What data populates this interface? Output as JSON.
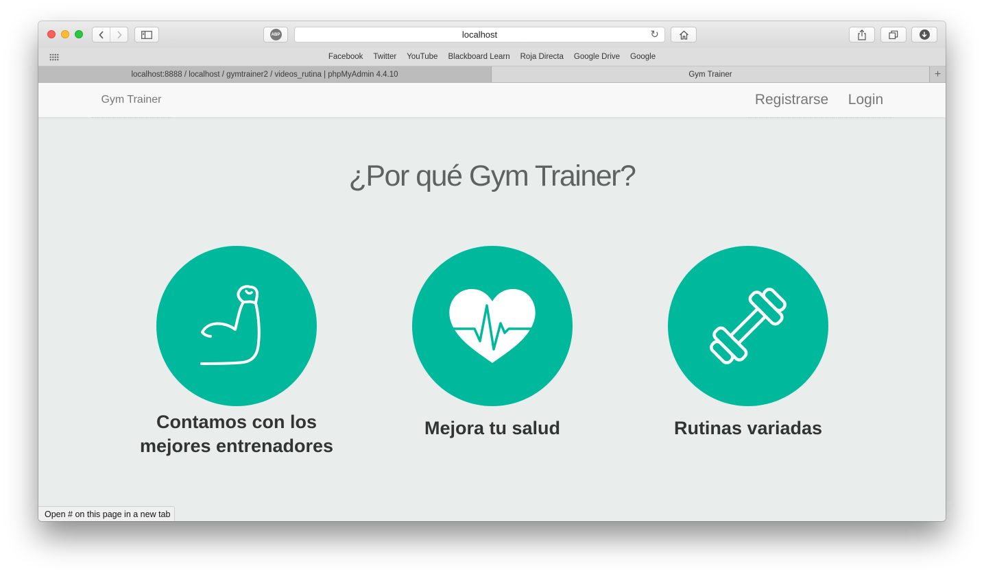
{
  "browser": {
    "address": "localhost",
    "bookmarks": [
      "Facebook",
      "Twitter",
      "YouTube",
      "Blackboard Learn",
      "Roja Directa",
      "Google Drive",
      "Google"
    ],
    "tabs": [
      {
        "label": "localhost:8888 / localhost / gymtrainer2 / videos_rutina | phpMyAdmin 4.4.10"
      },
      {
        "label": "Gym Trainer"
      }
    ],
    "new_tab": "+",
    "abp_label": "ABP",
    "status_text": "Open # on this page in a new tab"
  },
  "site": {
    "brand": "Gym Trainer",
    "nav": {
      "register": "Registrarse",
      "login": "Login"
    },
    "headline": "¿Por qué Gym Trainer?",
    "features": [
      {
        "icon": "flexed-arm-icon",
        "title": "Contamos con los mejores entrenadores"
      },
      {
        "icon": "heart-pulse-icon",
        "title": "Mejora tu salud"
      },
      {
        "icon": "dumbbell-icon",
        "title": "Rutinas variadas"
      }
    ],
    "accent_color": "#00b99c"
  }
}
